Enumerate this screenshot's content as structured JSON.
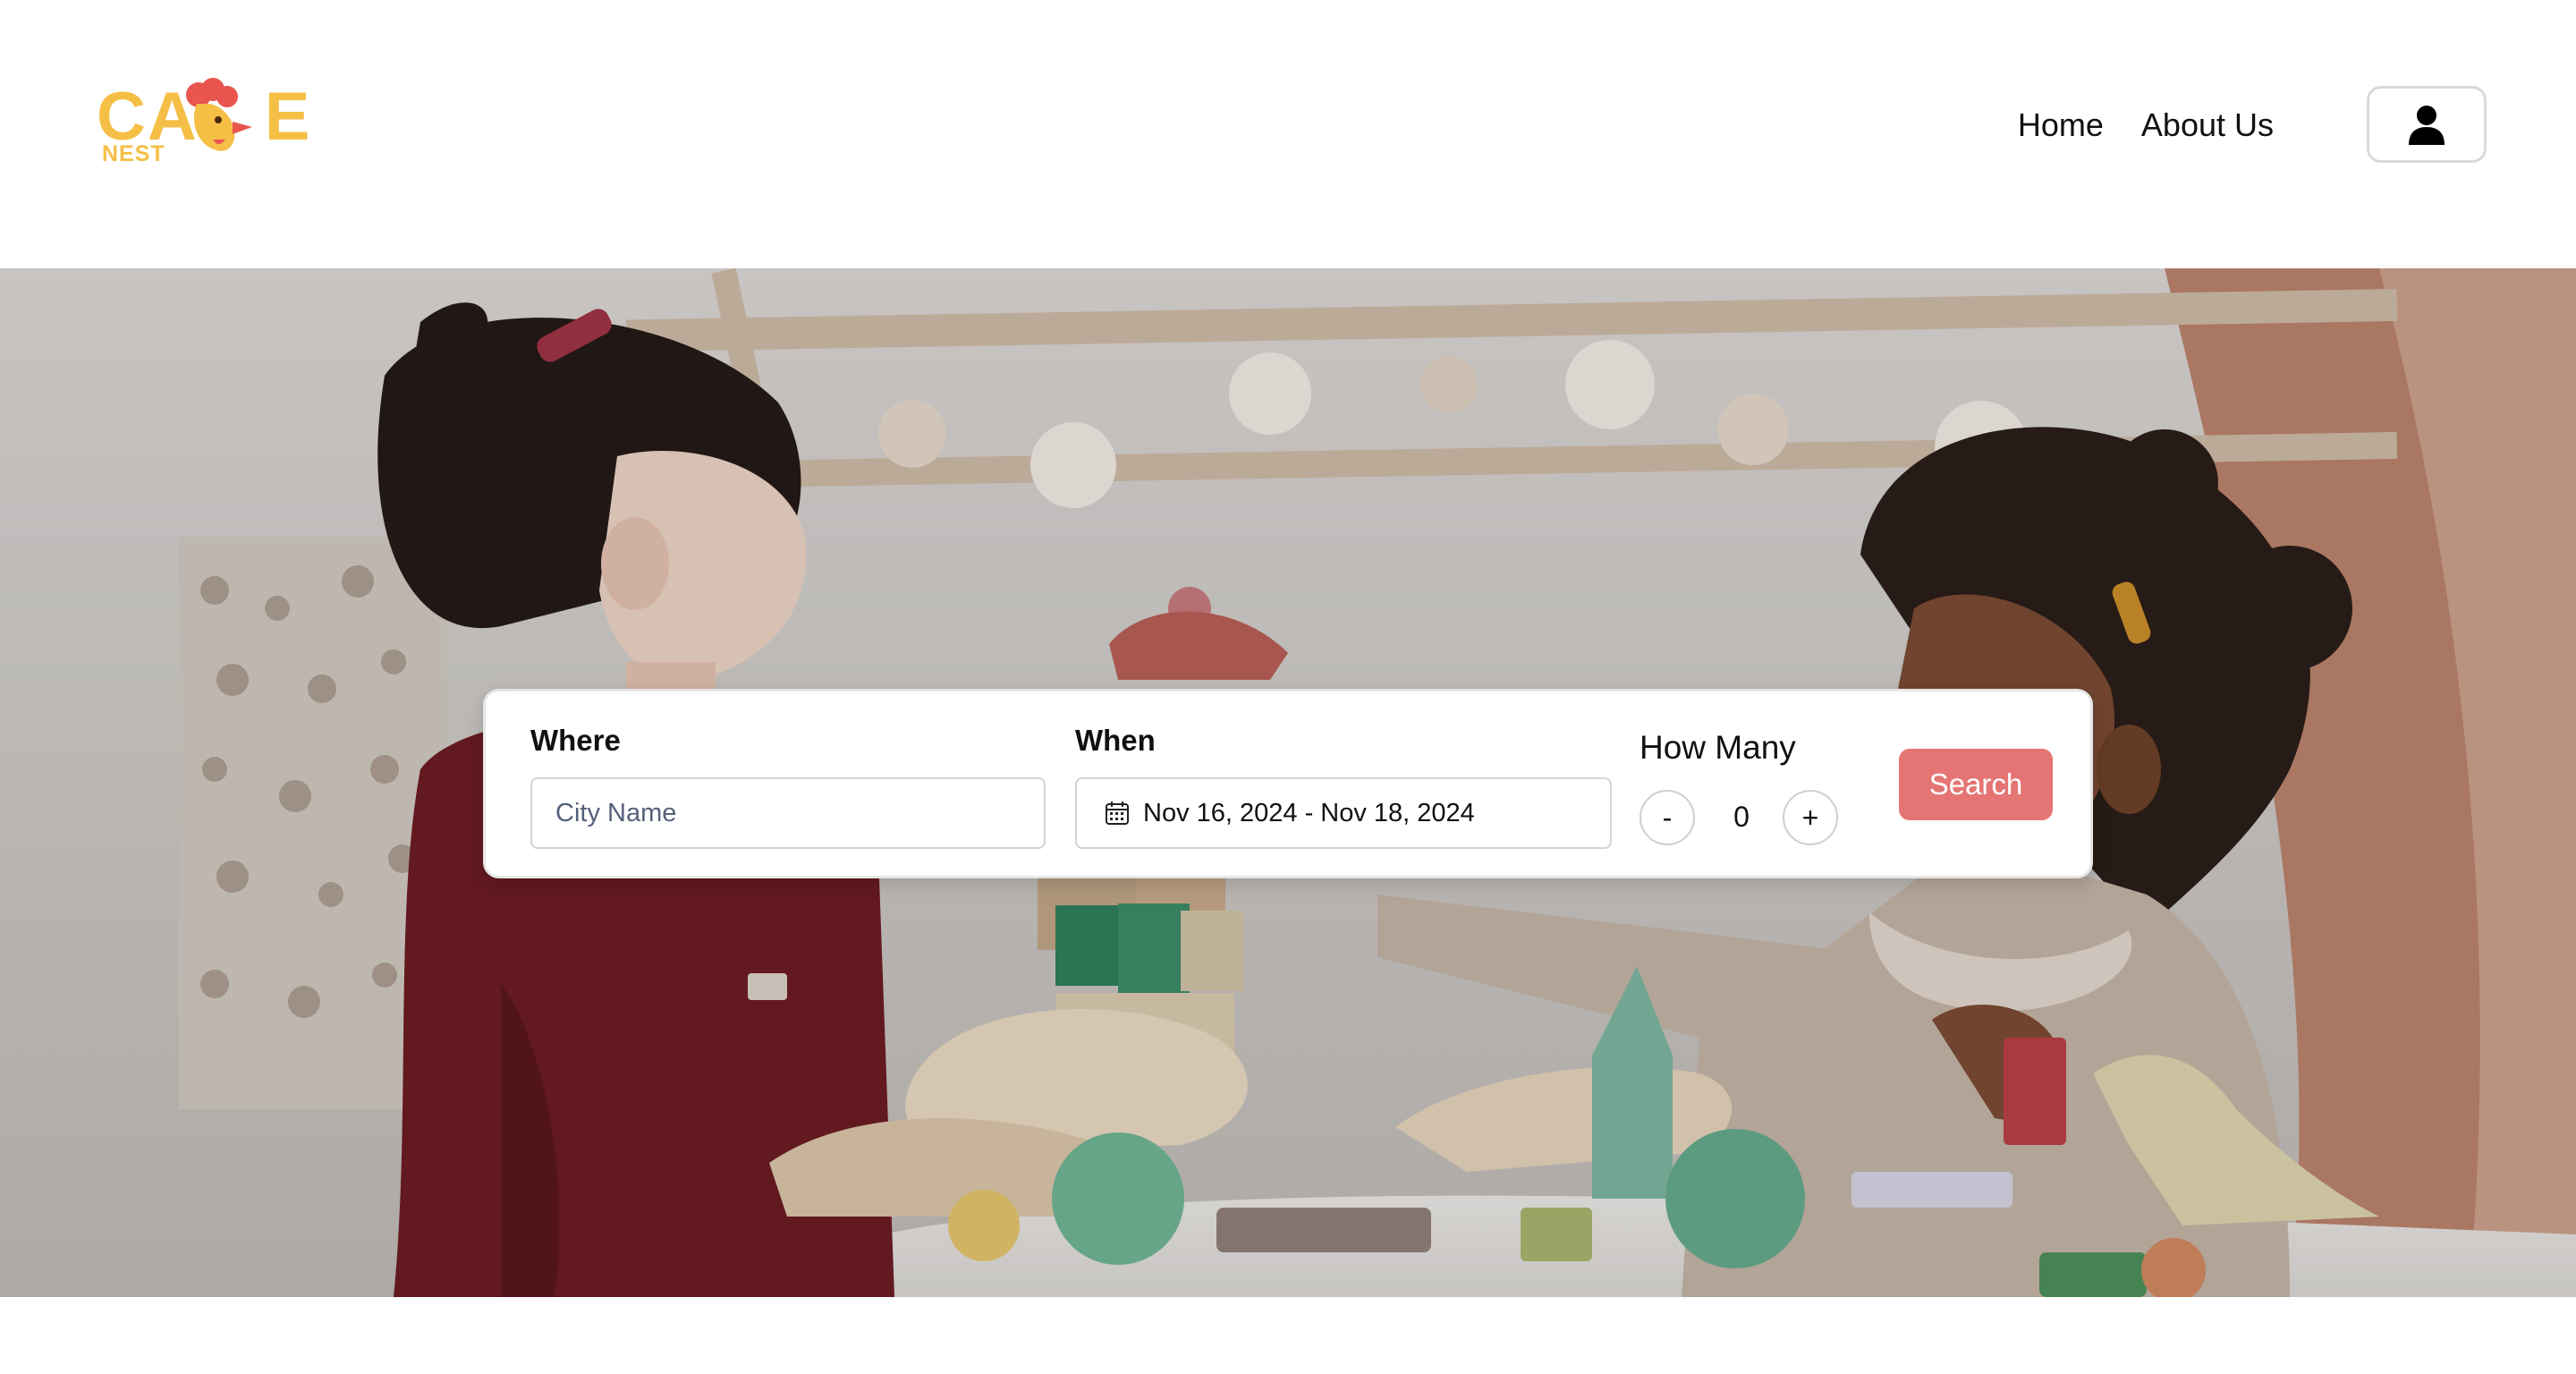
{
  "brand": {
    "logo_word_left": "CA",
    "logo_word_right": "E",
    "logo_sub": "NEST",
    "color": "#f5bf46",
    "accent": "#e8564f"
  },
  "nav": {
    "items": [
      {
        "label": "Home"
      },
      {
        "label": "About Us"
      }
    ]
  },
  "header": {
    "user_icon": "user-icon"
  },
  "search": {
    "where_label": "Where",
    "where_placeholder": "City Name",
    "when_label": "When",
    "when_value": "Nov 16, 2024 - Nov 18, 2024",
    "how_many_label": "How Many",
    "decrement_label": "-",
    "count": "0",
    "increment_label": "+",
    "search_label": "Search",
    "search_color": "#e57575"
  }
}
